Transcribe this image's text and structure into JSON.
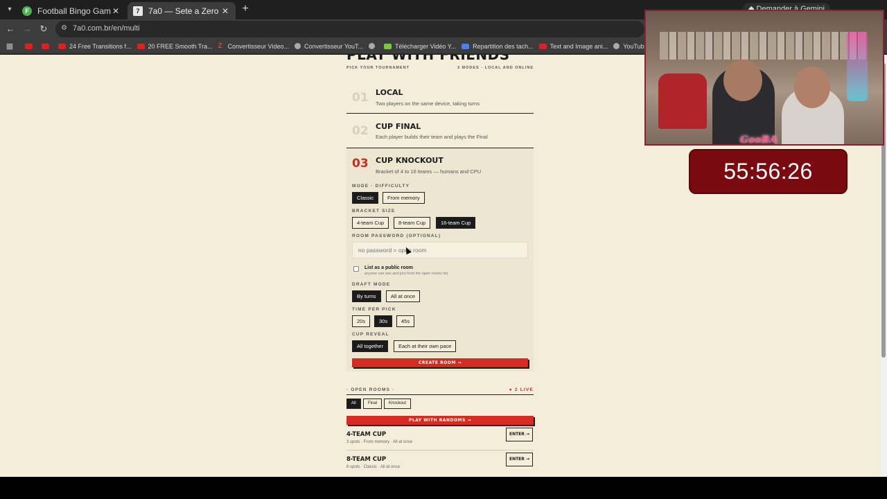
{
  "browser": {
    "tabs": [
      {
        "title": "Football Bingo Game - Play No",
        "favicon": "F"
      },
      {
        "title": "7a0 — Sete a Zero",
        "favicon": "7"
      }
    ],
    "gemini_label": "Demander à Gemini",
    "url": "7a0.com.br/en/multi",
    "bookmarks": [
      {
        "icon": "youtube-icon",
        "label": ""
      },
      {
        "icon": "youtube-icon",
        "label": ""
      },
      {
        "icon": "youtube-icon",
        "label": "24 Free Transitions f..."
      },
      {
        "icon": "youtube-icon",
        "label": "20 FREE Smooth Tra..."
      },
      {
        "icon": "z-icon",
        "label": "Convertisseur Video..."
      },
      {
        "icon": "globe-icon",
        "label": "Convertisseur YouT..."
      },
      {
        "icon": "globe-icon",
        "label": ""
      },
      {
        "icon": "download-icon",
        "label": "Télécharger Vidéo Y..."
      },
      {
        "icon": "doc-icon",
        "label": "Repartition des tach..."
      },
      {
        "icon": "youtube-icon",
        "label": "Text and Image ani..."
      },
      {
        "icon": "globe-icon",
        "label": "YouTube Converter..."
      }
    ]
  },
  "page": {
    "heading": "PLAY WITH FRIENDS",
    "pick_label": "PICK YOUR TOURNAMENT",
    "modes_count": "3 MODES · LOCAL AND ONLINE",
    "modes": [
      {
        "num": "01",
        "name": "LOCAL",
        "desc": "Two players on the same device, taking turns"
      },
      {
        "num": "02",
        "name": "CUP FINAL",
        "desc": "Each player builds their team and plays the Final"
      },
      {
        "num": "03",
        "name": "CUP KNOCKOUT",
        "desc": "Bracket of 4 to 16 teams — humans and CPU"
      }
    ],
    "difficulty": {
      "label": "MODE · DIFFICULTY",
      "options": [
        "Classic",
        "From memory"
      ],
      "selected": "Classic"
    },
    "bracket": {
      "label": "BRACKET SIZE",
      "options": [
        "4-team Cup",
        "8-team Cup",
        "16-team Cup"
      ],
      "selected": "16-team Cup"
    },
    "password": {
      "label": "ROOM PASSWORD (OPTIONAL)",
      "placeholder": "no password = open room",
      "value": ""
    },
    "public": {
      "label": "List as a public room",
      "sub": "anyone can see and join from the open rooms list",
      "checked": false
    },
    "draft": {
      "label": "DRAFT MODE",
      "options": [
        "By turns",
        "All at once"
      ],
      "selected": "By turns"
    },
    "time": {
      "label": "TIME PER PICK",
      "options": [
        "20s",
        "30s",
        "45s"
      ],
      "selected": "30s"
    },
    "reveal": {
      "label": "CUP REVEAL",
      "options": [
        "All together",
        "Each at their own pace"
      ],
      "selected": "All together"
    },
    "create_button": "CREATE ROOM →",
    "rooms": {
      "label": "· OPEN ROOMS ·",
      "live": "● 2 LIVE",
      "filters": [
        "All",
        "Final",
        "Knockout"
      ],
      "selected_filter": "All",
      "random_button": "PLAY WITH RANDOMS →",
      "list": [
        {
          "name": "4-TEAM CUP",
          "meta": "3 spots · From memory · All at once",
          "enter": "ENTER →"
        },
        {
          "name": "8-TEAM CUP",
          "meta": "6 spots · Classic · All at once",
          "enter": "ENTER →"
        }
      ]
    }
  },
  "overlay": {
    "cam_tag": "GooBA",
    "timer": "55:56:26"
  },
  "colors": {
    "accent_red": "#d62b22",
    "ink": "#1b1b1b",
    "paper": "#f3edd9",
    "timer_bg": "#7a0a0f"
  }
}
